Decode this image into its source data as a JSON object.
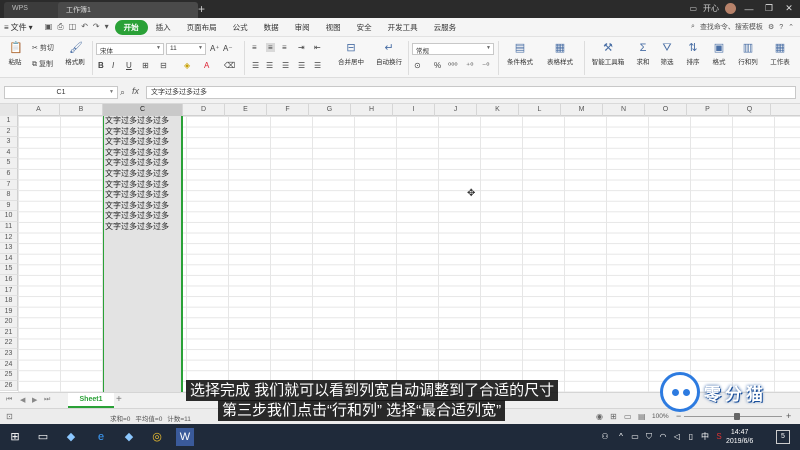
{
  "titlebar": {
    "tabs": [
      {
        "label": "WPS"
      },
      {
        "label": "工作簿1"
      }
    ],
    "new_tab": "+",
    "right_label": "开心"
  },
  "menubar": {
    "file_label": "文件",
    "items": [
      {
        "label": "开始",
        "active": true
      },
      {
        "label": "插入"
      },
      {
        "label": "页面布局"
      },
      {
        "label": "公式"
      },
      {
        "label": "数据"
      },
      {
        "label": "审阅"
      },
      {
        "label": "视图"
      },
      {
        "label": "安全"
      },
      {
        "label": "开发工具"
      },
      {
        "label": "云服务"
      }
    ],
    "search_label": "查找命令、搜索模板"
  },
  "ribbon": {
    "paste": "粘贴",
    "cut": "剪切",
    "copy": "复制",
    "format_painter": "格式刷",
    "font_name": "宋体",
    "font_size": "11",
    "number_format": "常规",
    "merge_center": "合并居中",
    "wrap_text": "自动换行",
    "conditional_format": "条件格式",
    "table_style": "表格样式",
    "smart_toolbox": "智能工具箱",
    "sum": "求和",
    "filter": "筛选",
    "sort": "排序",
    "format": "格式",
    "row_col": "行和列",
    "worksheet": "工作表"
  },
  "formula_bar": {
    "name_box": "C1",
    "fx": "fx",
    "content": "文字过多过多过多"
  },
  "grid": {
    "columns": [
      "A",
      "B",
      "C",
      "D",
      "E",
      "F",
      "G",
      "H",
      "I",
      "J",
      "K",
      "L",
      "M",
      "N",
      "O",
      "P",
      "Q"
    ],
    "selected_column": "C",
    "rows": [
      "1",
      "2",
      "3",
      "4",
      "5",
      "6",
      "7",
      "8",
      "9",
      "10",
      "11",
      "12",
      "13",
      "14",
      "15",
      "16",
      "17",
      "18",
      "19",
      "20",
      "21",
      "22",
      "23",
      "24",
      "25",
      "26"
    ],
    "c_cells": [
      "文字过多过多过多",
      "文字过多过多过多",
      "文字过多过多过多",
      "文字过多过多过多",
      "文字过多过多过多",
      "文字过多过多过多",
      "文字过多过多过多",
      "文字过多过多过多",
      "文字过多过多过多",
      "文字过多过多过多",
      "文字过多过多过多"
    ]
  },
  "sheets": {
    "active": "Sheet1",
    "add": "+"
  },
  "status": {
    "sum": "求和=0",
    "average": "平均值=0",
    "count": "计数=11",
    "zoom": "100%"
  },
  "taskbar": {
    "time": "14:47",
    "date": "2019/6/6",
    "notify_count": "5",
    "ime": "中"
  },
  "subtitles": {
    "line1": "选择完成  我们就可以看到列宽自动调整到了合适的尺寸",
    "line2": "第三步我们点击“行和列” 选择“最合适列宽”"
  },
  "logo": {
    "text": "零分猫"
  }
}
